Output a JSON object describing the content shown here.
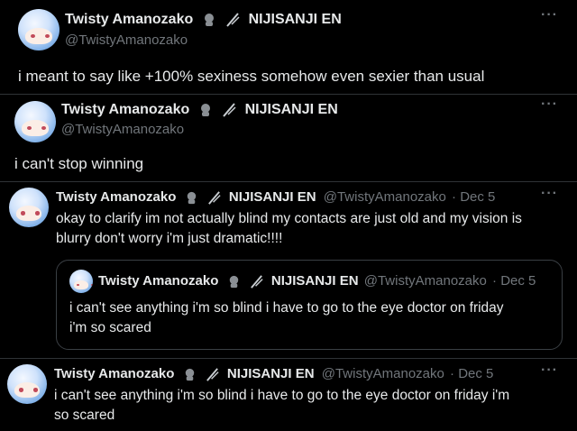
{
  "tweets": [
    {
      "name": "Twisty Amanozako",
      "org": "NIJISANJI EN",
      "handle": "@TwistyAmanozako",
      "text": "i meant to say like +100% sexiness somehow even sexier than usual"
    },
    {
      "name": "Twisty Amanozako",
      "org": "NIJISANJI EN",
      "handle": "@TwistyAmanozako",
      "text": "i can't stop winning"
    },
    {
      "name": "Twisty Amanozako",
      "org": "NIJISANJI EN",
      "handle": "@TwistyAmanozako",
      "date": "· Dec 5",
      "text_line1": "okay to clarify im not actually blind my contacts are just old and my vision is",
      "text_line2": "blurry don't worry i'm just dramatic!!!!",
      "quote": {
        "name": "Twisty Amanozako",
        "org": "NIJISANJI EN",
        "handle": "@TwistyAmanozako",
        "date": "· Dec 5",
        "text_line1": "i can't see anything i'm so blind i have to go to the eye doctor on friday",
        "text_line2": "i'm so scared"
      }
    },
    {
      "name": "Twisty Amanozako",
      "org": "NIJISANJI EN",
      "handle": "@TwistyAmanozako",
      "date": "· Dec 5",
      "text_line1": "i can't see anything i'm so blind i have to go to the eye doctor on friday i'm",
      "text_line2": "so scared"
    }
  ],
  "icons": {
    "more": "more-options-icon",
    "badge_avatar": "affiliate-avatar-badge-icon",
    "badge_org": "nijisanji-logo-icon"
  },
  "more_glyph": "···"
}
